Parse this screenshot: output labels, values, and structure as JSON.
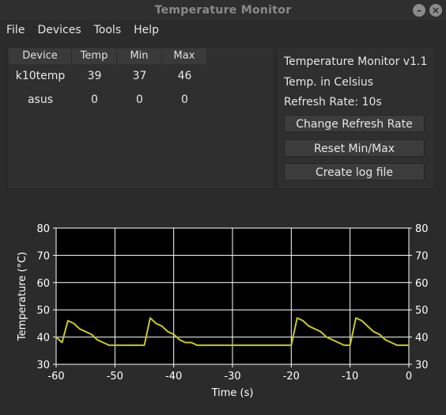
{
  "window": {
    "title": "Temperature Monitor"
  },
  "menu": [
    "File",
    "Devices",
    "Tools",
    "Help"
  ],
  "table": {
    "columns": [
      "Device",
      "Temp",
      "Min",
      "Max"
    ],
    "rows": [
      [
        "k10temp",
        "39",
        "37",
        "46"
      ],
      [
        "asus",
        "0",
        "0",
        "0"
      ]
    ]
  },
  "info": {
    "version": "Temperature Monitor v1.1",
    "units": "Temp. in Celsius",
    "refresh": "Refresh Rate: 10s"
  },
  "buttons": {
    "change_refresh": "Change Refresh Rate",
    "reset_minmax": "Reset Min/Max",
    "create_log": "Create log file"
  },
  "colors": {
    "line": "#c8c822",
    "plot_bg": "#000000",
    "grid": "#ffffff"
  },
  "chart_data": {
    "type": "line",
    "xlabel": "Time (s)",
    "ylabel": "Temperature (°C)",
    "xlim": [
      -60,
      0
    ],
    "ylim": [
      30,
      80
    ],
    "xticks": [
      "-60",
      "-50",
      "-40",
      "-30",
      "-20",
      "-10",
      "0"
    ],
    "yticks": [
      "30",
      "40",
      "50",
      "60",
      "70",
      "80"
    ],
    "grid": true,
    "series": [
      {
        "x": [
          -60,
          -59,
          -58,
          -57,
          -56,
          -55,
          -54,
          -53,
          -52,
          -51,
          -50,
          -49,
          -48,
          -47,
          -46,
          -45,
          -44,
          -43,
          -42,
          -41,
          -40,
          -39,
          -38,
          -37,
          -36,
          -35,
          -34,
          -33,
          -32,
          -31,
          -30,
          -29,
          -28,
          -27,
          -26,
          -25,
          -24,
          -23,
          -22,
          -21,
          -20,
          -19,
          -18,
          -17,
          -16,
          -15,
          -14,
          -13,
          -12,
          -11,
          -10,
          -9,
          -8,
          -7,
          -6,
          -5,
          -4,
          -3,
          -2,
          -1,
          0
        ],
        "values": [
          40,
          38,
          46,
          45,
          43,
          42,
          41,
          39,
          38,
          37,
          37,
          37,
          37,
          37,
          37,
          37,
          47,
          45,
          44,
          42,
          41,
          39,
          38,
          38,
          37,
          37,
          37,
          37,
          37,
          37,
          37,
          37,
          37,
          37,
          37,
          37,
          37,
          37,
          37,
          37,
          37,
          47,
          46,
          44,
          43,
          42,
          40,
          39,
          38,
          37,
          37,
          47,
          46,
          44,
          42,
          41,
          39,
          38,
          37,
          37,
          37
        ]
      }
    ]
  }
}
